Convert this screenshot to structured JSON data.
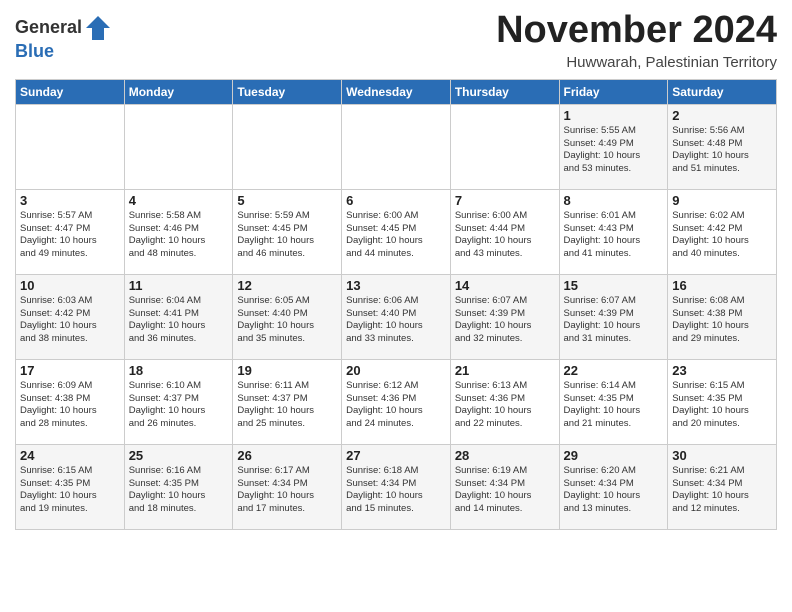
{
  "logo": {
    "general": "General",
    "blue": "Blue"
  },
  "title": "November 2024",
  "location": "Huwwarah, Palestinian Territory",
  "days_header": [
    "Sunday",
    "Monday",
    "Tuesday",
    "Wednesday",
    "Thursday",
    "Friday",
    "Saturday"
  ],
  "weeks": [
    [
      {
        "day": "",
        "info": ""
      },
      {
        "day": "",
        "info": ""
      },
      {
        "day": "",
        "info": ""
      },
      {
        "day": "",
        "info": ""
      },
      {
        "day": "",
        "info": ""
      },
      {
        "day": "1",
        "info": "Sunrise: 5:55 AM\nSunset: 4:49 PM\nDaylight: 10 hours\nand 53 minutes."
      },
      {
        "day": "2",
        "info": "Sunrise: 5:56 AM\nSunset: 4:48 PM\nDaylight: 10 hours\nand 51 minutes."
      }
    ],
    [
      {
        "day": "3",
        "info": "Sunrise: 5:57 AM\nSunset: 4:47 PM\nDaylight: 10 hours\nand 49 minutes."
      },
      {
        "day": "4",
        "info": "Sunrise: 5:58 AM\nSunset: 4:46 PM\nDaylight: 10 hours\nand 48 minutes."
      },
      {
        "day": "5",
        "info": "Sunrise: 5:59 AM\nSunset: 4:45 PM\nDaylight: 10 hours\nand 46 minutes."
      },
      {
        "day": "6",
        "info": "Sunrise: 6:00 AM\nSunset: 4:45 PM\nDaylight: 10 hours\nand 44 minutes."
      },
      {
        "day": "7",
        "info": "Sunrise: 6:00 AM\nSunset: 4:44 PM\nDaylight: 10 hours\nand 43 minutes."
      },
      {
        "day": "8",
        "info": "Sunrise: 6:01 AM\nSunset: 4:43 PM\nDaylight: 10 hours\nand 41 minutes."
      },
      {
        "day": "9",
        "info": "Sunrise: 6:02 AM\nSunset: 4:42 PM\nDaylight: 10 hours\nand 40 minutes."
      }
    ],
    [
      {
        "day": "10",
        "info": "Sunrise: 6:03 AM\nSunset: 4:42 PM\nDaylight: 10 hours\nand 38 minutes."
      },
      {
        "day": "11",
        "info": "Sunrise: 6:04 AM\nSunset: 4:41 PM\nDaylight: 10 hours\nand 36 minutes."
      },
      {
        "day": "12",
        "info": "Sunrise: 6:05 AM\nSunset: 4:40 PM\nDaylight: 10 hours\nand 35 minutes."
      },
      {
        "day": "13",
        "info": "Sunrise: 6:06 AM\nSunset: 4:40 PM\nDaylight: 10 hours\nand 33 minutes."
      },
      {
        "day": "14",
        "info": "Sunrise: 6:07 AM\nSunset: 4:39 PM\nDaylight: 10 hours\nand 32 minutes."
      },
      {
        "day": "15",
        "info": "Sunrise: 6:07 AM\nSunset: 4:39 PM\nDaylight: 10 hours\nand 31 minutes."
      },
      {
        "day": "16",
        "info": "Sunrise: 6:08 AM\nSunset: 4:38 PM\nDaylight: 10 hours\nand 29 minutes."
      }
    ],
    [
      {
        "day": "17",
        "info": "Sunrise: 6:09 AM\nSunset: 4:38 PM\nDaylight: 10 hours\nand 28 minutes."
      },
      {
        "day": "18",
        "info": "Sunrise: 6:10 AM\nSunset: 4:37 PM\nDaylight: 10 hours\nand 26 minutes."
      },
      {
        "day": "19",
        "info": "Sunrise: 6:11 AM\nSunset: 4:37 PM\nDaylight: 10 hours\nand 25 minutes."
      },
      {
        "day": "20",
        "info": "Sunrise: 6:12 AM\nSunset: 4:36 PM\nDaylight: 10 hours\nand 24 minutes."
      },
      {
        "day": "21",
        "info": "Sunrise: 6:13 AM\nSunset: 4:36 PM\nDaylight: 10 hours\nand 22 minutes."
      },
      {
        "day": "22",
        "info": "Sunrise: 6:14 AM\nSunset: 4:35 PM\nDaylight: 10 hours\nand 21 minutes."
      },
      {
        "day": "23",
        "info": "Sunrise: 6:15 AM\nSunset: 4:35 PM\nDaylight: 10 hours\nand 20 minutes."
      }
    ],
    [
      {
        "day": "24",
        "info": "Sunrise: 6:15 AM\nSunset: 4:35 PM\nDaylight: 10 hours\nand 19 minutes."
      },
      {
        "day": "25",
        "info": "Sunrise: 6:16 AM\nSunset: 4:35 PM\nDaylight: 10 hours\nand 18 minutes."
      },
      {
        "day": "26",
        "info": "Sunrise: 6:17 AM\nSunset: 4:34 PM\nDaylight: 10 hours\nand 17 minutes."
      },
      {
        "day": "27",
        "info": "Sunrise: 6:18 AM\nSunset: 4:34 PM\nDaylight: 10 hours\nand 15 minutes."
      },
      {
        "day": "28",
        "info": "Sunrise: 6:19 AM\nSunset: 4:34 PM\nDaylight: 10 hours\nand 14 minutes."
      },
      {
        "day": "29",
        "info": "Sunrise: 6:20 AM\nSunset: 4:34 PM\nDaylight: 10 hours\nand 13 minutes."
      },
      {
        "day": "30",
        "info": "Sunrise: 6:21 AM\nSunset: 4:34 PM\nDaylight: 10 hours\nand 12 minutes."
      }
    ]
  ]
}
